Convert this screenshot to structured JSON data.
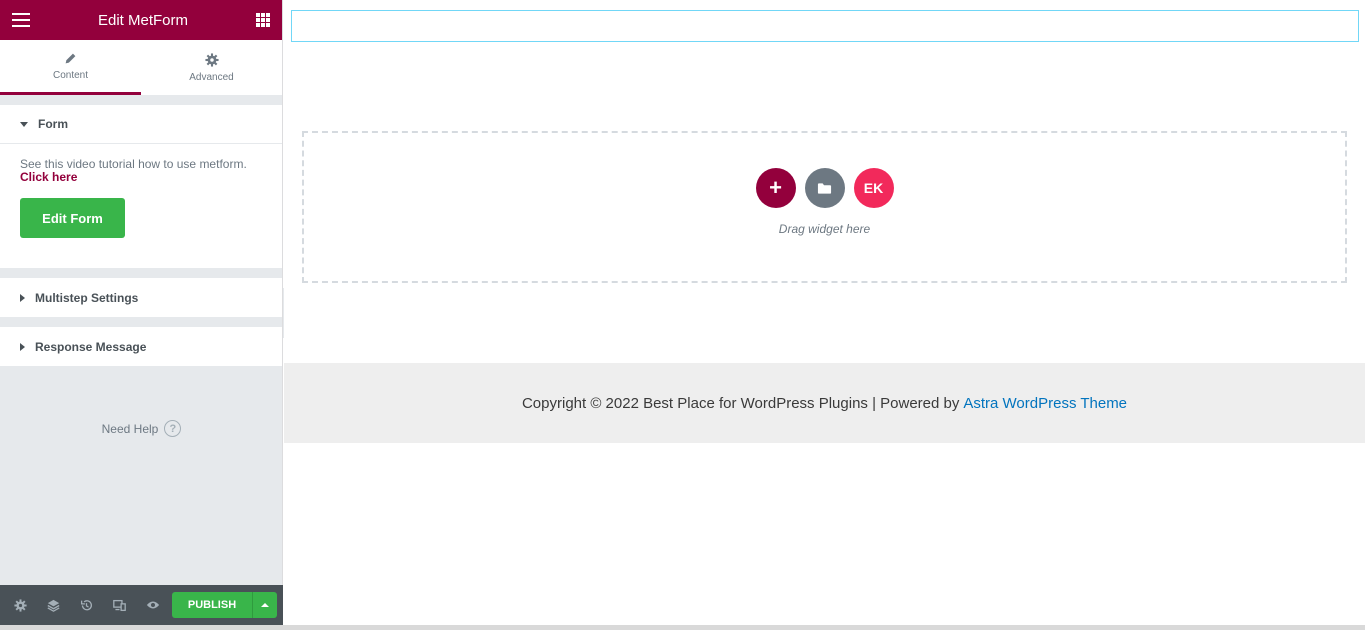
{
  "panel": {
    "title": "Edit MetForm",
    "tabs": [
      {
        "label": "Content",
        "icon": "pencil-icon",
        "active": true
      },
      {
        "label": "Advanced",
        "icon": "gear-icon",
        "active": false
      }
    ],
    "sections": {
      "form": {
        "title": "Form",
        "description": "See this video tutorial how to use metform.",
        "link_text": "Click here",
        "button_label": "Edit Form"
      },
      "multistep": {
        "title": "Multistep Settings"
      },
      "response": {
        "title": "Response Message"
      }
    },
    "need_help": "Need Help",
    "help_glyph": "?",
    "footer": {
      "tools": [
        "settings-icon",
        "navigator-layers-icon",
        "history-icon",
        "responsive-mode-icon",
        "preview-eye-icon"
      ],
      "publish_label": "PUBLISH"
    }
  },
  "preview": {
    "drop_zone": {
      "add_glyph": "+",
      "ek_glyph": "EK",
      "hint": "Drag widget here"
    },
    "footer": {
      "text": "Copyright © 2022 Best Place for WordPress Plugins | Powered by",
      "link_text": "Astra WordPress Theme"
    }
  },
  "colors": {
    "brand": "#93003c",
    "publish_green": "#39b54a",
    "link_blue": "#0274be",
    "ek_pink": "#f2295b"
  }
}
